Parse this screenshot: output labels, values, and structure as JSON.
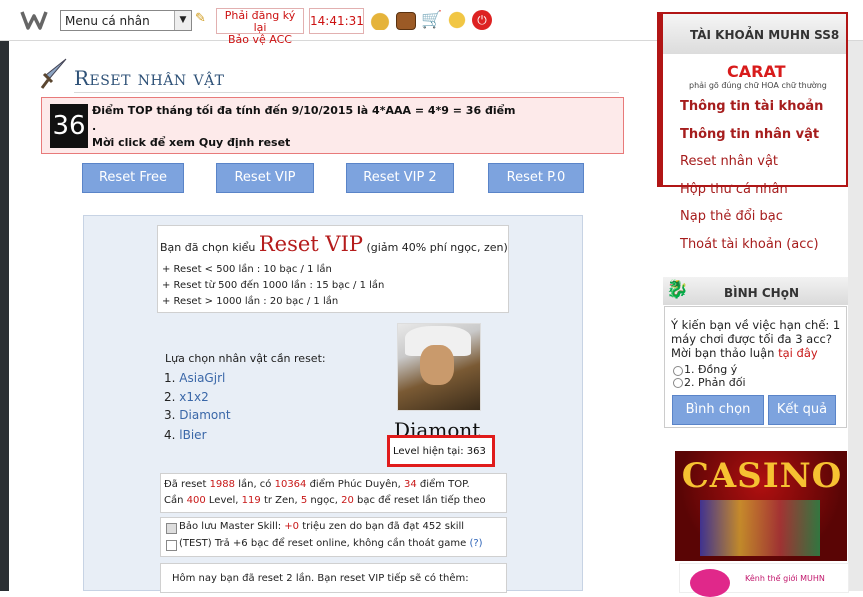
{
  "topbar": {
    "menu_select": "Menu cá nhân",
    "register_line1": "Phải đăng ký lại",
    "register_line2": "Bảo vệ ACC",
    "clock": "14:41:31"
  },
  "page": {
    "title": "Reset nhân vật"
  },
  "notice": {
    "number": "36",
    "line1": "Điểm TOP tháng tối đa tính đến 9/10/2015 là 4*AAA = 4*9 = 36 điểm",
    "line2": ".",
    "line3": "Mời click để xem Quy định reset"
  },
  "reset_buttons": [
    "Reset Free",
    "Reset VIP",
    "Reset VIP 2",
    "Reset P.0"
  ],
  "vip_info": {
    "prefix": "Bạn đã chọn kiểu ",
    "type": "Reset VIP",
    "suffix": " (giảm 40% phí ngọc, zen)",
    "rules": [
      "+ Reset < 500 lần : 10 bạc / 1 lần",
      "+ Reset từ 500 đến 1000 lần : 15 bạc / 1 lần",
      "+ Reset > 1000 lần : 20 bạc / 1 lần"
    ]
  },
  "characters": {
    "label": "Lựa chọn nhân vật cần reset:",
    "items": [
      {
        "num": "1.",
        "name": "AsiaGjrl"
      },
      {
        "num": "2.",
        "name": "x1x2"
      },
      {
        "num": "3.",
        "name": "Diamont"
      },
      {
        "num": "4.",
        "name": "lBier"
      }
    ],
    "selected_name": "Diamont",
    "level_text": "Level hiện tại: 363"
  },
  "stats": {
    "l1_a": "Đã reset ",
    "l1_resets": "1988",
    "l1_b": " lần, có ",
    "l1_points": "10364",
    "l1_c": " điểm Phúc Duyên, ",
    "l1_top": "34",
    "l1_d": " điểm TOP.",
    "l2_a": "Cần ",
    "l2_level": "400",
    "l2_b": " Level, ",
    "l2_zen": "119",
    "l2_c": " tr Zen, ",
    "l2_gems": "5",
    "l2_d": " ngọc, ",
    "l2_silver": "20",
    "l2_e": " bạc để reset lần tiếp theo"
  },
  "options": {
    "opt1_a": "Bảo lưu Master Skill: ",
    "opt1_val": "+0",
    "opt1_b": " triệu zen do bạn đã đạt 452 skill",
    "opt2": "(TEST) Trả +6 bạc để reset online, không cần thoát game ",
    "opt2_help": "(?)"
  },
  "today": "Hôm nay bạn đã reset 2 lần. Bạn reset VIP tiếp sẽ có thêm:",
  "sidebar": {
    "account_title": "TÀI KHOẢN MUHN SS8",
    "username": "CARAT",
    "username_hint": "phải gõ đúng chữ HOA chữ thường",
    "links": [
      "Thông tin tài khoản",
      "Thông tin nhân vật",
      "Reset nhân vật",
      "Hộp thư cá nhân",
      "Nạp thẻ đổi bạc",
      "Thoát tài khoản (acc)"
    ],
    "poll_title": "BÌNH CHọN",
    "poll_question": "Ý kiến bạn về việc hạn chế: 1 máy chơi được tối đa 3 acc? Mời bạn thảo luận ",
    "poll_link": "tại đây",
    "poll_options": [
      "1. Đồng ý",
      "2. Phản đối"
    ],
    "vote_label": "Bình chọn",
    "results_label": "Kết quả",
    "casino_text": "CASINO",
    "channel_text": "Kênh thế giới MUHN"
  },
  "colors": {
    "accent_red": "#c81818",
    "button_blue": "#7da3de",
    "title_blue": "#2e5177"
  }
}
